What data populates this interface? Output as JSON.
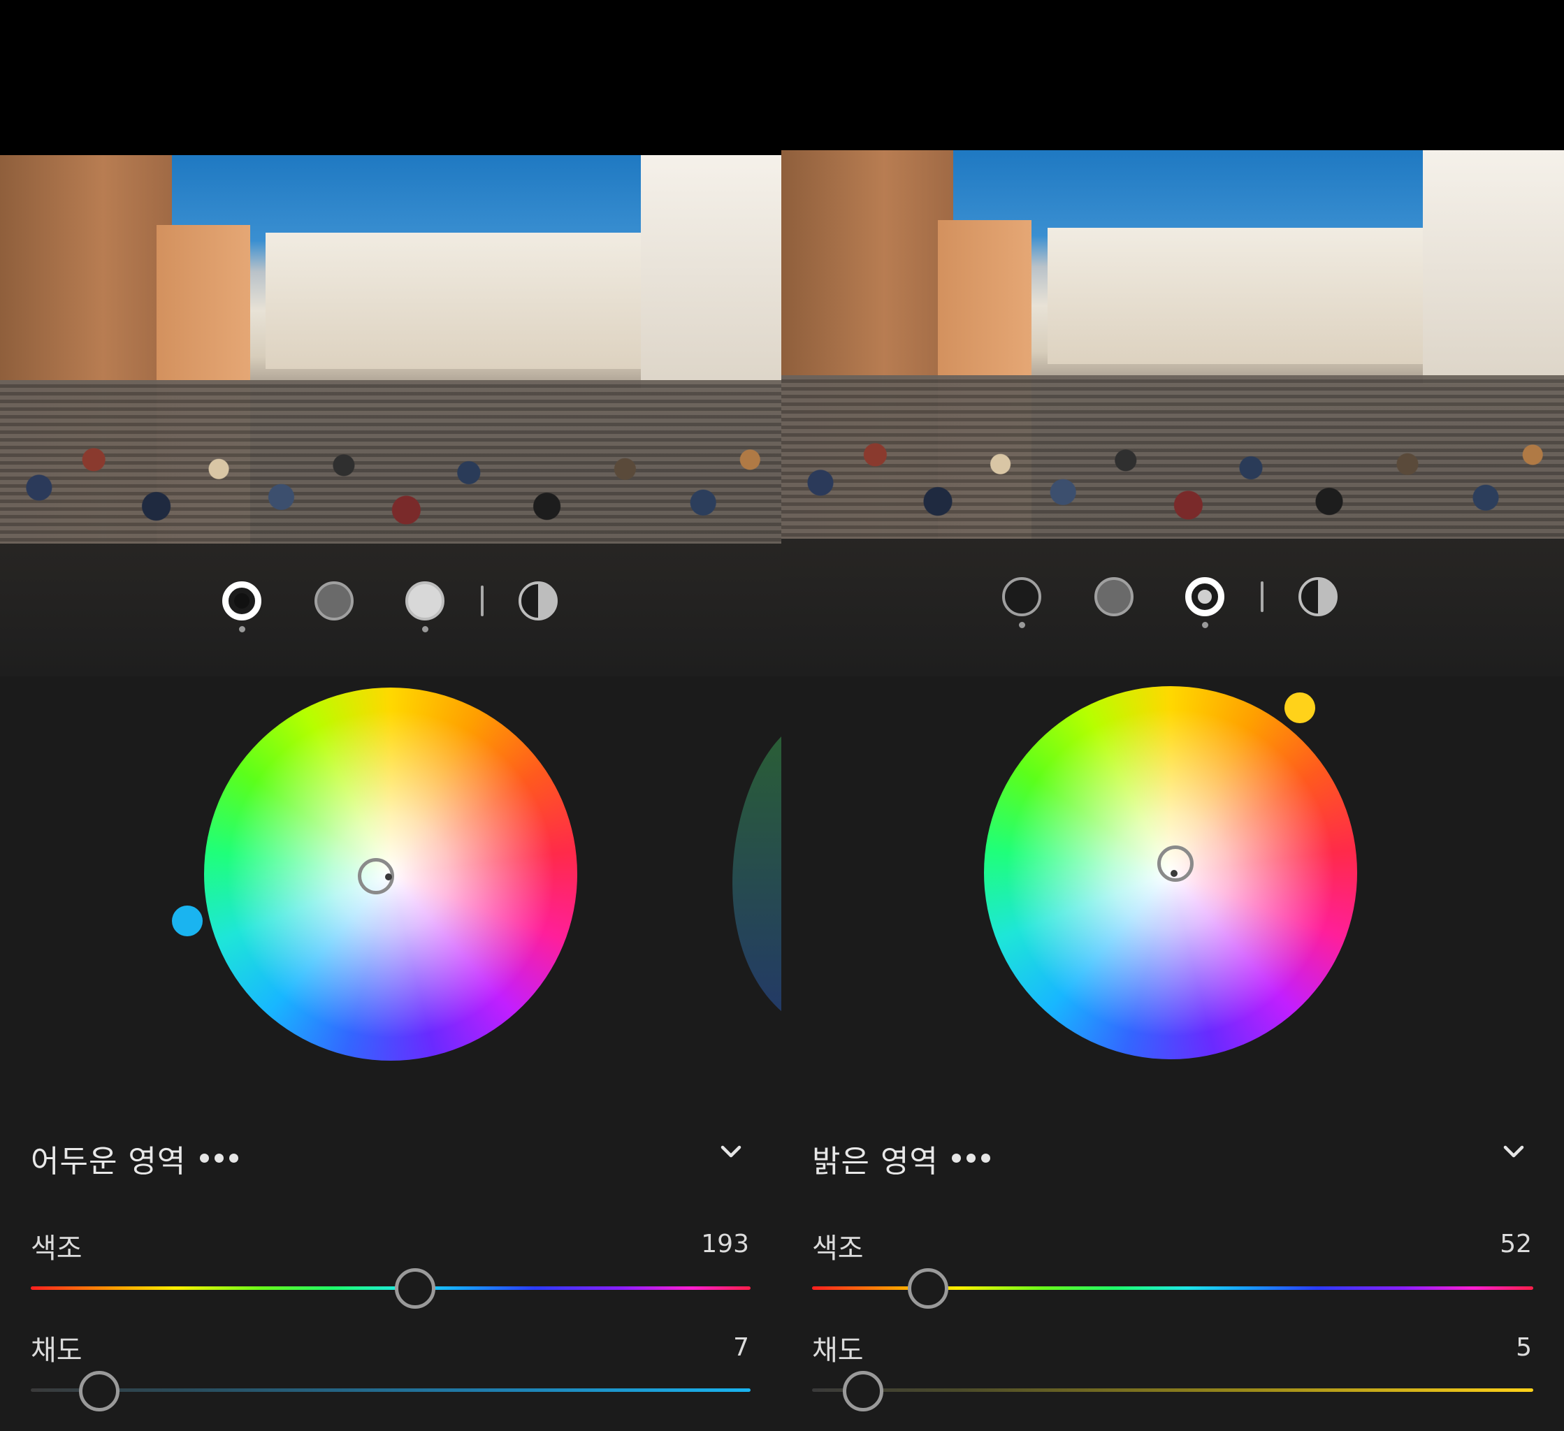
{
  "left_panel": {
    "tone_selected": "shadows",
    "section_title": "어두운 영역",
    "more_icon": "more-horizontal-icon",
    "collapse_icon": "chevron-down-icon",
    "hue": {
      "label": "색조",
      "value": "193",
      "fraction": 0.536
    },
    "saturation": {
      "label": "채도",
      "value": "7",
      "fraction": 0.07
    },
    "knob_color": "#1ab4f0"
  },
  "right_panel": {
    "tone_selected": "highlights",
    "section_title": "밝은 영역",
    "more_icon": "more-horizontal-icon",
    "collapse_icon": "chevron-down-icon",
    "hue": {
      "label": "색조",
      "value": "52",
      "fraction": 0.144
    },
    "saturation": {
      "label": "채도",
      "value": "5",
      "fraction": 0.05
    },
    "knob_color": "#ffd21a"
  },
  "tone_buttons": [
    "shadows",
    "midtones",
    "highlights",
    "global"
  ],
  "colors": {
    "background": "#1b1b1b",
    "track_neutral": "#3a3a3a",
    "thumb_border": "#9a9a9a"
  }
}
